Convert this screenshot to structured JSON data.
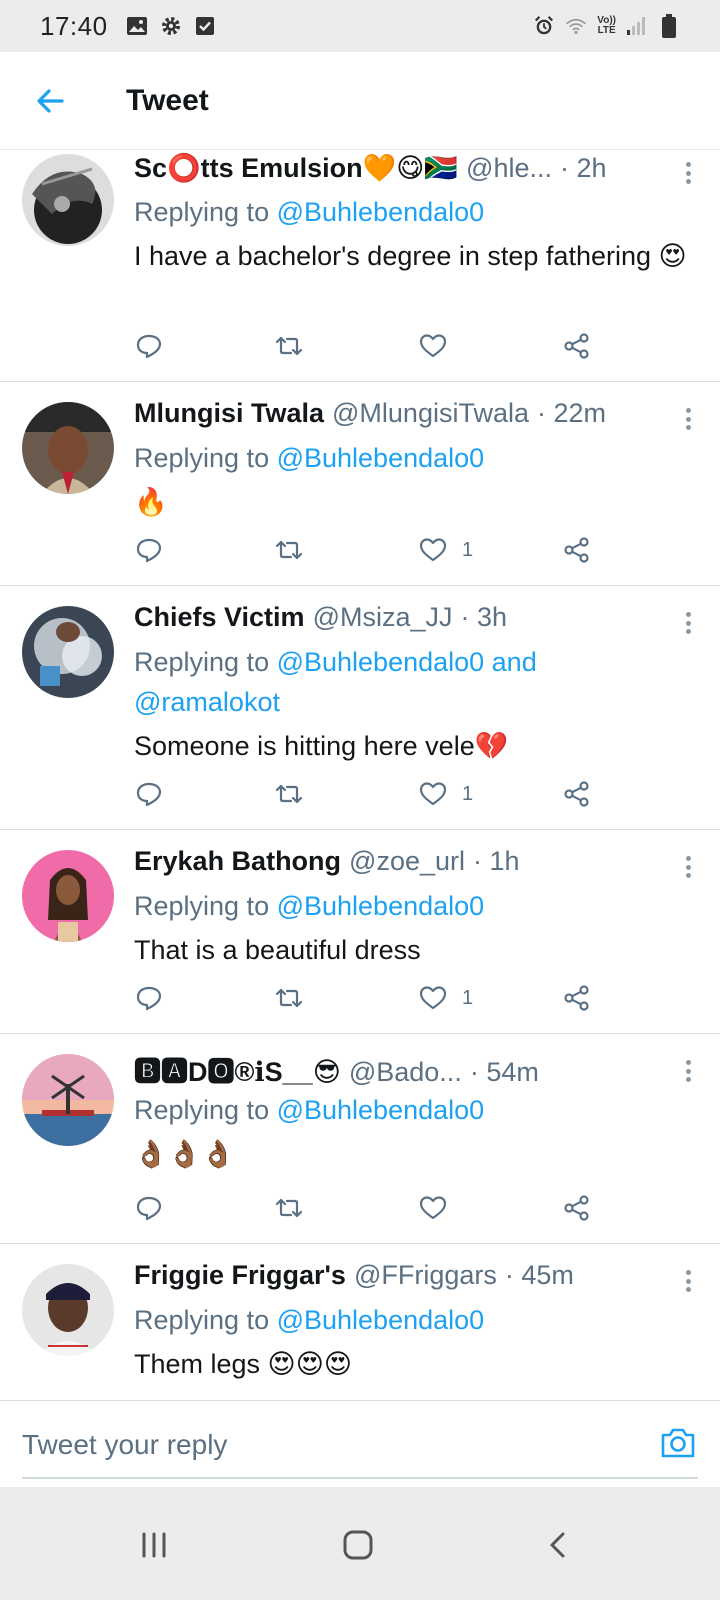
{
  "status_bar": {
    "time": "17:40",
    "left_icons": [
      "gallery-icon",
      "gear-icon",
      "checkbox-icon"
    ],
    "right_icons": [
      "alarm-icon",
      "wifi-icon",
      "volte-icon",
      "signal-icon",
      "battery-icon"
    ],
    "volte_top": "Vo))",
    "volte_bottom": "LTE"
  },
  "header": {
    "title": "Tweet",
    "back_icon": "arrow-left-icon",
    "accent_color": "#1da1f2"
  },
  "tweets": [
    {
      "name": "Sc⭕tts Emulsion🧡😋🇿🇦",
      "handle": "@hle...",
      "time": "· 2h",
      "replying_prefix": "Replying to ",
      "replying_to": "@Buhlebendalo0",
      "text": "I have a bachelor's degree in step fathering 😍",
      "likes": ""
    },
    {
      "name": "Mlungisi Twala",
      "handle": "@MlungisiTwala",
      "time": "· 22m",
      "replying_prefix": "Replying to ",
      "replying_to": "@Buhlebendalo0",
      "text": "🔥",
      "likes": "1"
    },
    {
      "name": "Chiefs Victim",
      "handle": "@Msiza_JJ",
      "time": "· 3h",
      "replying_prefix": "Replying to ",
      "replying_to": "@Buhlebendalo0 and @ramalokot",
      "text": "Someone is hitting here vele💔",
      "likes": "1"
    },
    {
      "name": "Erykah Bathong",
      "handle": "@zoe_url",
      "time": "· 1h",
      "replying_prefix": "Replying to ",
      "replying_to": "@Buhlebendalo0",
      "text": "That is a beautiful dress",
      "likes": "1"
    },
    {
      "name": "🅱🅰D🅾®ℹS__😎",
      "handle": "@Bado...",
      "time": "· 54m",
      "replying_prefix": "Replying to ",
      "replying_to": "@Buhlebendalo0",
      "text": "👌🏾👌🏾👌🏾",
      "likes": ""
    },
    {
      "name": "Friggie Friggar's",
      "handle": "@FFriggars",
      "time": "· 45m",
      "replying_prefix": "Replying to ",
      "replying_to": "@Buhlebendalo0",
      "text": "Them legs 😍😍😍",
      "likes": ""
    }
  ],
  "reply_bar": {
    "placeholder": "Tweet your reply",
    "camera_icon": "camera-icon"
  },
  "nav_bar": {
    "buttons": [
      "recent-apps-icon",
      "home-icon",
      "back-icon"
    ]
  }
}
